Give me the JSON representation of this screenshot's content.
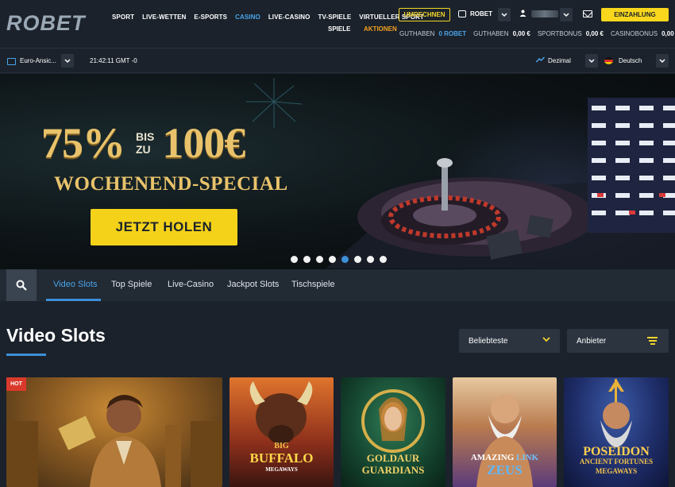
{
  "brand": {
    "logo_text": "ROBET"
  },
  "nav": {
    "items": [
      {
        "label": "SPORT",
        "active": false
      },
      {
        "label": "LIVE-WETTEN",
        "active": false
      },
      {
        "label": "E-SPORTS",
        "active": false
      },
      {
        "label": "CASINO",
        "active": true
      },
      {
        "label": "LIVE-CASINO",
        "active": false
      },
      {
        "label": "TV-SPIELE",
        "active": false
      },
      {
        "label": "VIRTUELLER SPORT",
        "active": false
      }
    ],
    "sub_spiele": "SPIELE",
    "aktionen": "AKTIONEN"
  },
  "header": {
    "umrechnen_label": "UMRECHNEN",
    "wallet_label": "ROBET",
    "einzahlung_label": "EINZAHLUNG"
  },
  "balances": [
    {
      "label": "GUTHABEN",
      "value": "0 ROBET",
      "highlight": true
    },
    {
      "label": "GUTHABEN",
      "value": "0,00 €",
      "highlight": false
    },
    {
      "label": "SPORTBONUS",
      "value": "0,00 €",
      "highlight": false
    },
    {
      "label": "CASINOBONUS",
      "value": "0,00 €",
      "highlight": false
    }
  ],
  "secondbar": {
    "odds_format": "Euro-Ansic...",
    "clock": "21:42:11 GMT -0",
    "odds_type": "Dezimal",
    "language": "Deutsch"
  },
  "hero": {
    "percent": "75%",
    "bis": "BIS",
    "zu": "ZU",
    "amount": "100€",
    "subtitle": "WOCHENEND-SPECIAL",
    "cta": "JETZT HOLEN",
    "slide_count": 8,
    "active_slide": 5
  },
  "tabs": [
    {
      "label": "Video Slots",
      "active": true
    },
    {
      "label": "Top Spiele",
      "active": false
    },
    {
      "label": "Live-Casino",
      "active": false
    },
    {
      "label": "Jackpot Slots",
      "active": false
    },
    {
      "label": "Tischspiele",
      "active": false
    }
  ],
  "content": {
    "section_title": "Video Slots",
    "sort_label": "Beliebteste",
    "provider_label": "Anbieter",
    "hot_badge": "HOT",
    "games": [
      {
        "line1": "",
        "line2": "",
        "line3": ""
      },
      {
        "line1": "BIG",
        "line2": "BUFFALO",
        "line3": "MEGAWAYS"
      },
      {
        "line1": "",
        "line2": "GOLDAUR",
        "line3": "GUARDIANS"
      },
      {
        "line1": "AMAZING",
        "line2": "LINK",
        "line3": "ZEUS"
      },
      {
        "line1": "POSEIDON",
        "line2": "ANCIENT FORTUNES",
        "line3": "MEGAWAYS"
      }
    ]
  },
  "colors": {
    "accent_blue": "#3d8fd6",
    "accent_yellow": "#f5d21a",
    "aktionen_orange": "#f0a020",
    "hot_red": "#d93a2b"
  }
}
